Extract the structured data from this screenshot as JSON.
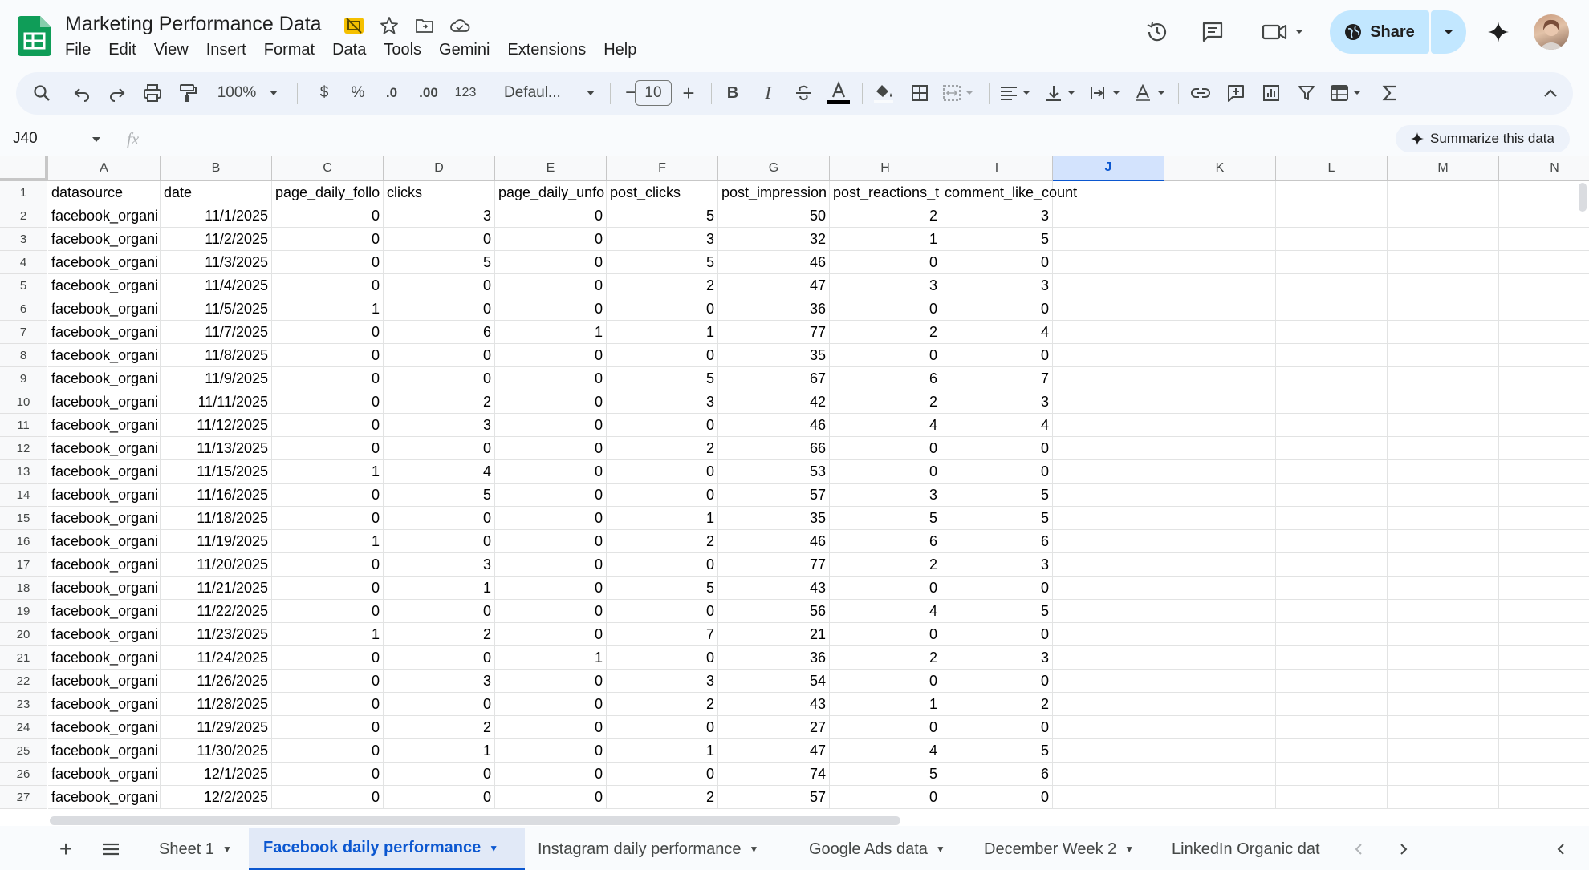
{
  "app": {
    "title": "Marketing Performance Data",
    "menu": [
      "File",
      "Edit",
      "View",
      "Insert",
      "Format",
      "Data",
      "Tools",
      "Gemini",
      "Extensions",
      "Help"
    ],
    "share_label": "Share",
    "accent": "#0b57d0",
    "share_bg": "#c2e7ff"
  },
  "toolbar": {
    "zoom": "100%",
    "currency": "$",
    "percent": "%",
    "decrease_decimal": ".0",
    "increase_decimal": ".00",
    "number_format": "123",
    "font": "Defaul...",
    "font_size": "10",
    "minus": "−",
    "plus": "+",
    "bold": "B",
    "italic": "I"
  },
  "formula_bar": {
    "name_box": "J40",
    "fx": "fx",
    "summarize": "Summarize this data"
  },
  "grid": {
    "columns": [
      "A",
      "B",
      "C",
      "D",
      "E",
      "F",
      "G",
      "H",
      "I",
      "J",
      "K",
      "L",
      "M",
      "N"
    ],
    "selected_column": "J",
    "header_row": [
      "datasource",
      "date",
      "page_daily_follo",
      "clicks",
      "page_daily_unfo",
      "post_clicks",
      "post_impression",
      "post_reactions_t",
      "comment_like_count"
    ],
    "rows": [
      {
        "n": "2",
        "datasource": "facebook_organi",
        "date": "11/1/2025",
        "c": "0",
        "d": "3",
        "e": "0",
        "f": "5",
        "g": "50",
        "h": "2",
        "i": "3"
      },
      {
        "n": "3",
        "datasource": "facebook_organi",
        "date": "11/2/2025",
        "c": "0",
        "d": "0",
        "e": "0",
        "f": "3",
        "g": "32",
        "h": "1",
        "i": "5"
      },
      {
        "n": "4",
        "datasource": "facebook_organi",
        "date": "11/3/2025",
        "c": "0",
        "d": "5",
        "e": "0",
        "f": "5",
        "g": "46",
        "h": "0",
        "i": "0"
      },
      {
        "n": "5",
        "datasource": "facebook_organi",
        "date": "11/4/2025",
        "c": "0",
        "d": "0",
        "e": "0",
        "f": "2",
        "g": "47",
        "h": "3",
        "i": "3"
      },
      {
        "n": "6",
        "datasource": "facebook_organi",
        "date": "11/5/2025",
        "c": "1",
        "d": "0",
        "e": "0",
        "f": "0",
        "g": "36",
        "h": "0",
        "i": "0"
      },
      {
        "n": "7",
        "datasource": "facebook_organi",
        "date": "11/7/2025",
        "c": "0",
        "d": "6",
        "e": "1",
        "f": "1",
        "g": "77",
        "h": "2",
        "i": "4"
      },
      {
        "n": "8",
        "datasource": "facebook_organi",
        "date": "11/8/2025",
        "c": "0",
        "d": "0",
        "e": "0",
        "f": "0",
        "g": "35",
        "h": "0",
        "i": "0"
      },
      {
        "n": "9",
        "datasource": "facebook_organi",
        "date": "11/9/2025",
        "c": "0",
        "d": "0",
        "e": "0",
        "f": "5",
        "g": "67",
        "h": "6",
        "i": "7"
      },
      {
        "n": "10",
        "datasource": "facebook_organi",
        "date": "11/11/2025",
        "c": "0",
        "d": "2",
        "e": "0",
        "f": "3",
        "g": "42",
        "h": "2",
        "i": "3"
      },
      {
        "n": "11",
        "datasource": "facebook_organi",
        "date": "11/12/2025",
        "c": "0",
        "d": "3",
        "e": "0",
        "f": "0",
        "g": "46",
        "h": "4",
        "i": "4"
      },
      {
        "n": "12",
        "datasource": "facebook_organi",
        "date": "11/13/2025",
        "c": "0",
        "d": "0",
        "e": "0",
        "f": "2",
        "g": "66",
        "h": "0",
        "i": "0"
      },
      {
        "n": "13",
        "datasource": "facebook_organi",
        "date": "11/15/2025",
        "c": "1",
        "d": "4",
        "e": "0",
        "f": "0",
        "g": "53",
        "h": "0",
        "i": "0"
      },
      {
        "n": "14",
        "datasource": "facebook_organi",
        "date": "11/16/2025",
        "c": "0",
        "d": "5",
        "e": "0",
        "f": "0",
        "g": "57",
        "h": "3",
        "i": "5"
      },
      {
        "n": "15",
        "datasource": "facebook_organi",
        "date": "11/18/2025",
        "c": "0",
        "d": "0",
        "e": "0",
        "f": "1",
        "g": "35",
        "h": "5",
        "i": "5"
      },
      {
        "n": "16",
        "datasource": "facebook_organi",
        "date": "11/19/2025",
        "c": "1",
        "d": "0",
        "e": "0",
        "f": "2",
        "g": "46",
        "h": "6",
        "i": "6"
      },
      {
        "n": "17",
        "datasource": "facebook_organi",
        "date": "11/20/2025",
        "c": "0",
        "d": "3",
        "e": "0",
        "f": "0",
        "g": "77",
        "h": "2",
        "i": "3"
      },
      {
        "n": "18",
        "datasource": "facebook_organi",
        "date": "11/21/2025",
        "c": "0",
        "d": "1",
        "e": "0",
        "f": "5",
        "g": "43",
        "h": "0",
        "i": "0"
      },
      {
        "n": "19",
        "datasource": "facebook_organi",
        "date": "11/22/2025",
        "c": "0",
        "d": "0",
        "e": "0",
        "f": "0",
        "g": "56",
        "h": "4",
        "i": "5"
      },
      {
        "n": "20",
        "datasource": "facebook_organi",
        "date": "11/23/2025",
        "c": "1",
        "d": "2",
        "e": "0",
        "f": "7",
        "g": "21",
        "h": "0",
        "i": "0"
      },
      {
        "n": "21",
        "datasource": "facebook_organi",
        "date": "11/24/2025",
        "c": "0",
        "d": "0",
        "e": "1",
        "f": "0",
        "g": "36",
        "h": "2",
        "i": "3"
      },
      {
        "n": "22",
        "datasource": "facebook_organi",
        "date": "11/26/2025",
        "c": "0",
        "d": "3",
        "e": "0",
        "f": "3",
        "g": "54",
        "h": "0",
        "i": "0"
      },
      {
        "n": "23",
        "datasource": "facebook_organi",
        "date": "11/28/2025",
        "c": "0",
        "d": "0",
        "e": "0",
        "f": "2",
        "g": "43",
        "h": "1",
        "i": "2"
      },
      {
        "n": "24",
        "datasource": "facebook_organi",
        "date": "11/29/2025",
        "c": "0",
        "d": "2",
        "e": "0",
        "f": "0",
        "g": "27",
        "h": "0",
        "i": "0"
      },
      {
        "n": "25",
        "datasource": "facebook_organi",
        "date": "11/30/2025",
        "c": "0",
        "d": "1",
        "e": "0",
        "f": "1",
        "g": "47",
        "h": "4",
        "i": "5"
      },
      {
        "n": "26",
        "datasource": "facebook_organi",
        "date": "12/1/2025",
        "c": "0",
        "d": "0",
        "e": "0",
        "f": "0",
        "g": "74",
        "h": "5",
        "i": "6"
      },
      {
        "n": "27",
        "datasource": "facebook_organi",
        "date": "12/2/2025",
        "c": "0",
        "d": "0",
        "e": "0",
        "f": "2",
        "g": "57",
        "h": "0",
        "i": "0"
      }
    ]
  },
  "sheets": {
    "tabs": [
      "Sheet 1",
      "Facebook daily performance",
      "Instagram daily performance",
      "Google Ads data",
      "December Week 2",
      "LinkedIn Organic dat"
    ],
    "active": "Facebook daily performance",
    "add": "+"
  }
}
